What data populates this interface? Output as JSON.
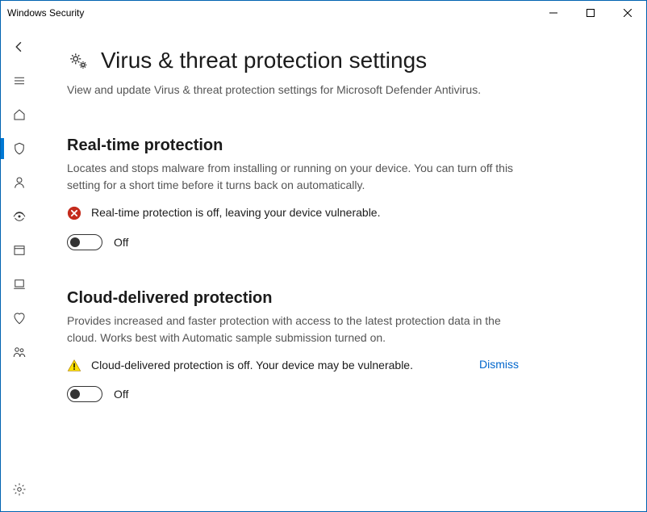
{
  "window": {
    "title": "Windows Security"
  },
  "page": {
    "heading": "Virus & threat protection settings",
    "subtitle": "View and update Virus & threat protection settings for Microsoft Defender Antivirus."
  },
  "sections": {
    "realtime": {
      "title": "Real-time protection",
      "desc": "Locates and stops malware from installing or running on your device. You can turn off this setting for a short time before it turns back on automatically.",
      "alert": "Real-time protection is off, leaving your device vulnerable.",
      "toggle_label": "Off"
    },
    "cloud": {
      "title": "Cloud-delivered protection",
      "desc": "Provides increased and faster protection with access to the latest protection data in the cloud. Works best with Automatic sample submission turned on.",
      "alert": "Cloud-delivered protection is off. Your device may be vulnerable.",
      "dismiss": "Dismiss",
      "toggle_label": "Off"
    }
  }
}
